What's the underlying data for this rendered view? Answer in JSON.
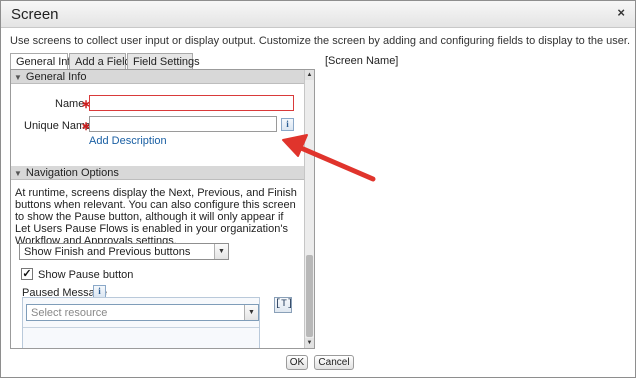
{
  "dialog": {
    "title": "Screen",
    "close_glyph": "×",
    "intro": "Use screens to collect user input or display output. Customize the screen by adding and configuring fields to display to the user."
  },
  "tabs": [
    {
      "label": "General Info",
      "active": true
    },
    {
      "label": "Add a Field",
      "active": false
    },
    {
      "label": "Field Settings",
      "active": false
    }
  ],
  "preview": {
    "screen_name": "[Screen Name]"
  },
  "general_info": {
    "header": "General Info",
    "name_label": "Name",
    "name_value": "",
    "unique_name_label": "Unique Name",
    "unique_name_value": "",
    "required_mark": "∗",
    "info_glyph": "i",
    "add_description": "Add Description"
  },
  "navigation": {
    "header": "Navigation Options",
    "description": "At runtime, screens display the Next, Previous, and Finish buttons when relevant. You can also configure this screen to show the Pause button, although it will only appear if Let Users Pause Flows is enabled in your organization's Workflow and Approvals settings.",
    "buttons_select": "Show Finish and Previous buttons",
    "show_pause_label": "Show Pause button",
    "show_pause_checked": true,
    "check_glyph": "✓",
    "paused_message_label": "Paused Message",
    "resource_placeholder": "Select resource"
  },
  "footer": {
    "ok": "OK",
    "cancel": "Cancel"
  },
  "colors": {
    "required": "#cc1d1d",
    "link": "#1a5fa3",
    "annotation_arrow": "#e0342c"
  }
}
